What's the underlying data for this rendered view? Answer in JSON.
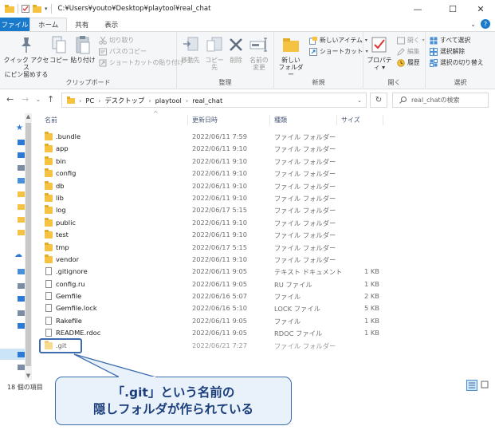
{
  "window": {
    "title": "C:¥Users¥youto¥Desktop¥playtool¥real_chat",
    "controls": {
      "minimize": "—",
      "maximize": "☐",
      "close": "✕",
      "help": "?"
    }
  },
  "ribbon_tabs": [
    "ファイル",
    "ホーム",
    "共有",
    "表示"
  ],
  "ribbon": {
    "clipboard": {
      "label": "クリップボード",
      "pin_line1": "クイック アクセス",
      "pin_line2": "にピン留めする",
      "copy": "コピー",
      "paste": "貼り付け",
      "cut": "切り取り",
      "copy_path": "パスのコピー",
      "paste_shortcut": "ショートカットの貼り付け"
    },
    "organize": {
      "label": "整理",
      "move_to": "移動先",
      "copy_to": "コピー先",
      "delete": "削除",
      "rename_line1": "名前の",
      "rename_line2": "変更"
    },
    "new": {
      "label": "新規",
      "new_folder_line1": "新しい",
      "new_folder_line2": "フォルダー",
      "new_item": "新しいアイテム",
      "shortcut": "ショートカット"
    },
    "open": {
      "label": "開く",
      "properties": "プロパティ",
      "open": "開く",
      "edit": "編集",
      "history": "履歴"
    },
    "select": {
      "label": "選択",
      "select_all": "すべて選択",
      "select_none": "選択解除",
      "invert": "選択の切り替え"
    }
  },
  "address": {
    "crumbs": [
      "PC",
      "デスクトップ",
      "playtool",
      "real_chat"
    ],
    "search_placeholder": "real_chatの検索"
  },
  "columns": {
    "name": "名前",
    "date": "更新日時",
    "type": "種類",
    "size": "サイズ"
  },
  "files": [
    {
      "name": ".bundle",
      "date": "2022/06/11 7:59",
      "type": "ファイル フォルダー",
      "size": "",
      "kind": "folder"
    },
    {
      "name": "app",
      "date": "2022/06/11 9:10",
      "type": "ファイル フォルダー",
      "size": "",
      "kind": "folder"
    },
    {
      "name": "bin",
      "date": "2022/06/11 9:10",
      "type": "ファイル フォルダー",
      "size": "",
      "kind": "folder"
    },
    {
      "name": "config",
      "date": "2022/06/11 9:10",
      "type": "ファイル フォルダー",
      "size": "",
      "kind": "folder"
    },
    {
      "name": "db",
      "date": "2022/06/11 9:10",
      "type": "ファイル フォルダー",
      "size": "",
      "kind": "folder"
    },
    {
      "name": "lib",
      "date": "2022/06/11 9:10",
      "type": "ファイル フォルダー",
      "size": "",
      "kind": "folder"
    },
    {
      "name": "log",
      "date": "2022/06/17 5:15",
      "type": "ファイル フォルダー",
      "size": "",
      "kind": "folder"
    },
    {
      "name": "public",
      "date": "2022/06/11 9:10",
      "type": "ファイル フォルダー",
      "size": "",
      "kind": "folder"
    },
    {
      "name": "test",
      "date": "2022/06/11 9:10",
      "type": "ファイル フォルダー",
      "size": "",
      "kind": "folder"
    },
    {
      "name": "tmp",
      "date": "2022/06/17 5:15",
      "type": "ファイル フォルダー",
      "size": "",
      "kind": "folder"
    },
    {
      "name": "vendor",
      "date": "2022/06/11 9:10",
      "type": "ファイル フォルダー",
      "size": "",
      "kind": "folder"
    },
    {
      "name": ".gitignore",
      "date": "2022/06/11 9:05",
      "type": "テキスト ドキュメント",
      "size": "1 KB",
      "kind": "file"
    },
    {
      "name": "config.ru",
      "date": "2022/06/11 9:05",
      "type": "RU ファイル",
      "size": "1 KB",
      "kind": "file"
    },
    {
      "name": "Gemfile",
      "date": "2022/06/16 5:07",
      "type": "ファイル",
      "size": "2 KB",
      "kind": "file"
    },
    {
      "name": "Gemfile.lock",
      "date": "2022/06/16 5:10",
      "type": "LOCK ファイル",
      "size": "5 KB",
      "kind": "file"
    },
    {
      "name": "Rakefile",
      "date": "2022/06/11 9:05",
      "type": "ファイル",
      "size": "1 KB",
      "kind": "file"
    },
    {
      "name": "README.rdoc",
      "date": "2022/06/11 9:05",
      "type": "RDOC ファイル",
      "size": "1 KB",
      "kind": "file"
    },
    {
      "name": ".git",
      "date": "2022/06/21 7:27",
      "type": "ファイル フォルダー",
      "size": "",
      "kind": "hidden-folder"
    }
  ],
  "status": {
    "item_count": "18 個の項目"
  },
  "callout": {
    "line1": "「.git」という名前の",
    "line2": "隠しフォルダが作られている"
  },
  "colors": {
    "accent": "#1979ca",
    "callout_border": "#3c6cad",
    "callout_fill": "#e9f2fb",
    "folder": "#f5c242"
  }
}
